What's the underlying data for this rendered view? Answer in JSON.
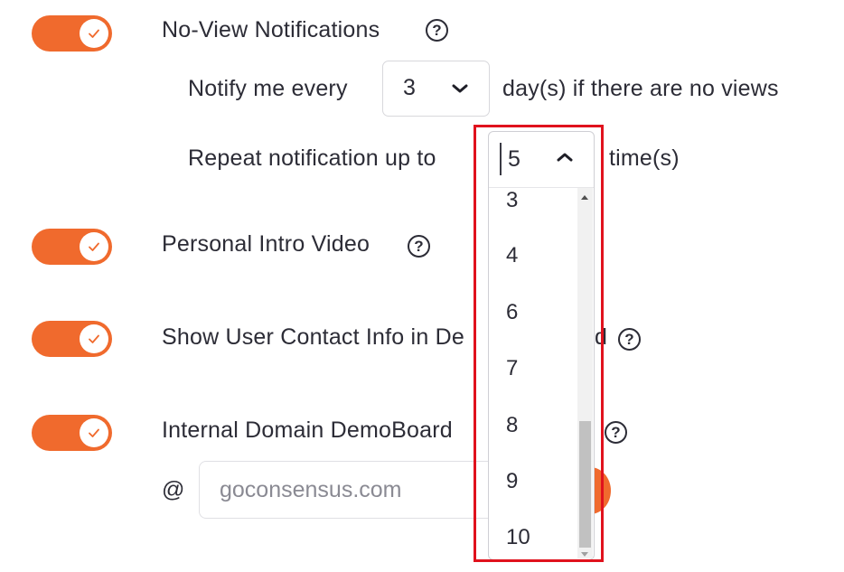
{
  "settings": {
    "no_view": {
      "title": "No-View Notifications",
      "notify_prefix": "Notify me every",
      "notify_value": "3",
      "notify_suffix": "day(s) if there are no views",
      "repeat_prefix": "Repeat notification up to",
      "repeat_value": "5",
      "repeat_suffix": "time(s)"
    },
    "intro_video": {
      "title": "Personal Intro Video"
    },
    "contact_info": {
      "title": "Show User Contact Info in De",
      "title_tail": "d"
    },
    "internal_domain": {
      "title": "Internal Domain DemoBoard",
      "at_symbol": "@",
      "domain_value": "goconsensus.com"
    }
  },
  "help_glyph": "?",
  "dropdown": {
    "selected": "5",
    "options": [
      "3",
      "4",
      "6",
      "7",
      "8",
      "9",
      "10"
    ]
  },
  "colors": {
    "accent": "#f06a2d",
    "highlight": "#e0121d"
  },
  "icons": {
    "toggle_check": "check-icon",
    "help": "question-circle-icon",
    "chevron": "chevron-icon"
  }
}
